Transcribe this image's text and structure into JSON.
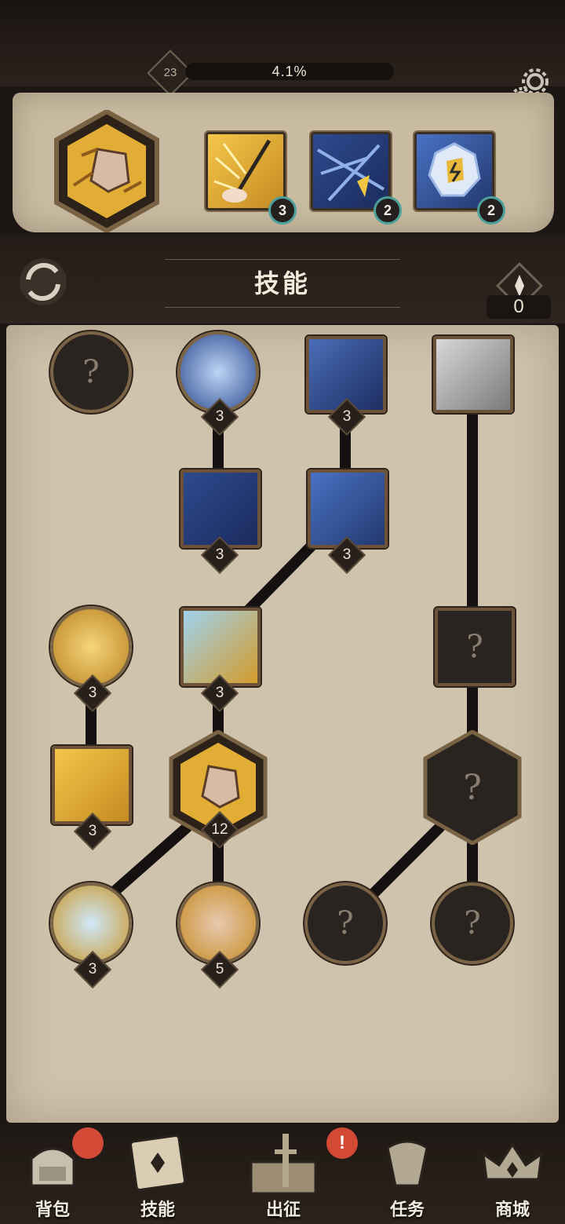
{
  "player": {
    "level": "23",
    "progress_text": "4.1%"
  },
  "equipped": {
    "slots": [
      {
        "name": "slot-gold-spikes",
        "count": "3"
      },
      {
        "name": "slot-blue-strike",
        "count": "2"
      },
      {
        "name": "slot-ice-shield",
        "count": "2"
      }
    ]
  },
  "header": {
    "title": "技能",
    "skill_points": "0"
  },
  "tree": {
    "counts": {
      "n01": "3",
      "n02": "3",
      "n11": "3",
      "n12": "3",
      "n20": "3",
      "n21": "3",
      "n30": "3",
      "n31": "12",
      "n40": "3",
      "n41": "5"
    },
    "locked_glyph": "?"
  },
  "nav": {
    "items": [
      {
        "label": "背包"
      },
      {
        "label": "技能"
      },
      {
        "label": "出征"
      },
      {
        "label": "任务"
      },
      {
        "label": "商城"
      }
    ],
    "alert_glyph": "!"
  },
  "colors": {
    "gold": "#e7b93a",
    "blue": "#2e4a8e",
    "locked": "#2a2421",
    "accent_badge": "#4fa09a",
    "alert": "#d24a36"
  }
}
